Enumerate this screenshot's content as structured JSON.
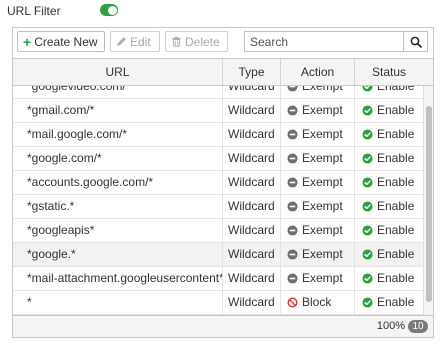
{
  "filter": {
    "label": "URL Filter",
    "enabled": true
  },
  "toolbar": {
    "create_label": "Create New",
    "edit_label": "Edit",
    "delete_label": "Delete"
  },
  "search": {
    "placeholder": "Search",
    "value": ""
  },
  "table": {
    "columns": {
      "url": "URL",
      "type": "Type",
      "action": "Action",
      "status": "Status"
    },
    "rows": [
      {
        "url": "*googlevideo.com/*",
        "type": "Wildcard",
        "action": "Exempt",
        "status": "Enable"
      },
      {
        "url": "*gmail.com/*",
        "type": "Wildcard",
        "action": "Exempt",
        "status": "Enable"
      },
      {
        "url": "*mail.google.com/*",
        "type": "Wildcard",
        "action": "Exempt",
        "status": "Enable"
      },
      {
        "url": "*google.com/*",
        "type": "Wildcard",
        "action": "Exempt",
        "status": "Enable"
      },
      {
        "url": "*accounts.google.com/*",
        "type": "Wildcard",
        "action": "Exempt",
        "status": "Enable"
      },
      {
        "url": "*gstatic.*",
        "type": "Wildcard",
        "action": "Exempt",
        "status": "Enable"
      },
      {
        "url": "*googleapis*",
        "type": "Wildcard",
        "action": "Exempt",
        "status": "Enable"
      },
      {
        "url": "*google.*",
        "type": "Wildcard",
        "action": "Exempt",
        "status": "Enable"
      },
      {
        "url": "*mail-attachment.googleusercontent*",
        "type": "Wildcard",
        "action": "Exempt",
        "status": "Enable"
      },
      {
        "url": "*",
        "type": "Wildcard",
        "action": "Block",
        "status": "Enable"
      }
    ]
  },
  "footer": {
    "zoom": "100%",
    "count": "10"
  },
  "icons": {
    "create": "plus-icon",
    "edit": "pencil-icon",
    "delete": "trash-icon",
    "search": "magnifier-icon",
    "exempt": "minus-circle-icon",
    "block": "prohibited-icon",
    "enable": "check-circle-icon"
  },
  "colors": {
    "accent_green": "#2f9e44",
    "exempt_gray": "#6f6f6f",
    "block_red": "#d9342b",
    "enable_green": "#2f9e44"
  }
}
